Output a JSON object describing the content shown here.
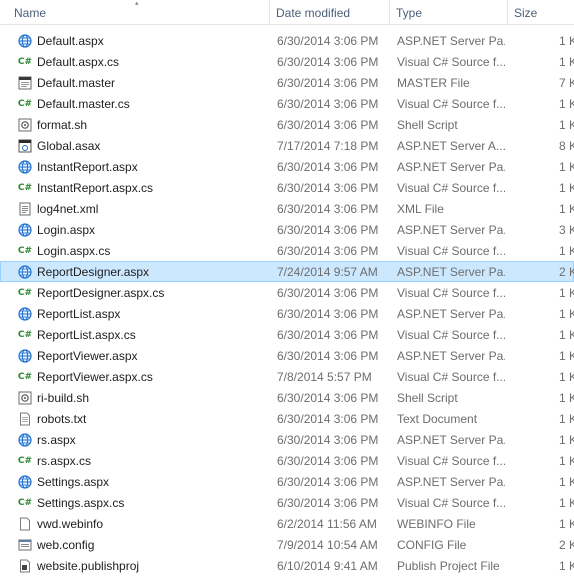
{
  "columns": {
    "name": "Name",
    "date": "Date modified",
    "type": "Type",
    "size": "Size"
  },
  "files": [
    {
      "name": "Default.aspx",
      "date": "6/30/2014 3:06 PM",
      "type": "ASP.NET Server Pa...",
      "size": "1 K",
      "icon": "globe-icon",
      "selected": false
    },
    {
      "name": "Default.aspx.cs",
      "date": "6/30/2014 3:06 PM",
      "type": "Visual C# Source f...",
      "size": "1 K",
      "icon": "csharp-icon",
      "selected": false
    },
    {
      "name": "Default.master",
      "date": "6/30/2014 3:06 PM",
      "type": "MASTER File",
      "size": "7 K",
      "icon": "master-file-icon",
      "selected": false
    },
    {
      "name": "Default.master.cs",
      "date": "6/30/2014 3:06 PM",
      "type": "Visual C# Source f...",
      "size": "1 K",
      "icon": "csharp-icon",
      "selected": false
    },
    {
      "name": "format.sh",
      "date": "6/30/2014 3:06 PM",
      "type": "Shell Script",
      "size": "1 K",
      "icon": "shell-script-icon",
      "selected": false
    },
    {
      "name": "Global.asax",
      "date": "7/17/2014 7:18 PM",
      "type": "ASP.NET Server A...",
      "size": "8 K",
      "icon": "asax-icon",
      "selected": false
    },
    {
      "name": "InstantReport.aspx",
      "date": "6/30/2014 3:06 PM",
      "type": "ASP.NET Server Pa...",
      "size": "1 K",
      "icon": "globe-icon",
      "selected": false
    },
    {
      "name": "InstantReport.aspx.cs",
      "date": "6/30/2014 3:06 PM",
      "type": "Visual C# Source f...",
      "size": "1 K",
      "icon": "csharp-icon",
      "selected": false
    },
    {
      "name": "log4net.xml",
      "date": "6/30/2014 3:06 PM",
      "type": "XML File",
      "size": "1 K",
      "icon": "xml-file-icon",
      "selected": false
    },
    {
      "name": "Login.aspx",
      "date": "6/30/2014 3:06 PM",
      "type": "ASP.NET Server Pa...",
      "size": "3 K",
      "icon": "globe-icon",
      "selected": false
    },
    {
      "name": "Login.aspx.cs",
      "date": "6/30/2014 3:06 PM",
      "type": "Visual C# Source f...",
      "size": "1 K",
      "icon": "csharp-icon",
      "selected": false
    },
    {
      "name": "ReportDesigner.aspx",
      "date": "7/24/2014 9:57 AM",
      "type": "ASP.NET Server Pa...",
      "size": "2 K",
      "icon": "globe-icon",
      "selected": true
    },
    {
      "name": "ReportDesigner.aspx.cs",
      "date": "6/30/2014 3:06 PM",
      "type": "Visual C# Source f...",
      "size": "1 K",
      "icon": "csharp-icon",
      "selected": false
    },
    {
      "name": "ReportList.aspx",
      "date": "6/30/2014 3:06 PM",
      "type": "ASP.NET Server Pa...",
      "size": "1 K",
      "icon": "globe-icon",
      "selected": false
    },
    {
      "name": "ReportList.aspx.cs",
      "date": "6/30/2014 3:06 PM",
      "type": "Visual C# Source f...",
      "size": "1 K",
      "icon": "csharp-icon",
      "selected": false
    },
    {
      "name": "ReportViewer.aspx",
      "date": "6/30/2014 3:06 PM",
      "type": "ASP.NET Server Pa...",
      "size": "1 K",
      "icon": "globe-icon",
      "selected": false
    },
    {
      "name": "ReportViewer.aspx.cs",
      "date": "7/8/2014 5:57 PM",
      "type": "Visual C# Source f...",
      "size": "1 K",
      "icon": "csharp-icon",
      "selected": false
    },
    {
      "name": "ri-build.sh",
      "date": "6/30/2014 3:06 PM",
      "type": "Shell Script",
      "size": "1 K",
      "icon": "shell-script-icon",
      "selected": false
    },
    {
      "name": "robots.txt",
      "date": "6/30/2014 3:06 PM",
      "type": "Text Document",
      "size": "1 K",
      "icon": "text-file-icon",
      "selected": false
    },
    {
      "name": "rs.aspx",
      "date": "6/30/2014 3:06 PM",
      "type": "ASP.NET Server Pa...",
      "size": "1 K",
      "icon": "globe-icon",
      "selected": false
    },
    {
      "name": "rs.aspx.cs",
      "date": "6/30/2014 3:06 PM",
      "type": "Visual C# Source f...",
      "size": "1 K",
      "icon": "csharp-icon",
      "selected": false
    },
    {
      "name": "Settings.aspx",
      "date": "6/30/2014 3:06 PM",
      "type": "ASP.NET Server Pa...",
      "size": "1 K",
      "icon": "globe-icon",
      "selected": false
    },
    {
      "name": "Settings.aspx.cs",
      "date": "6/30/2014 3:06 PM",
      "type": "Visual C# Source f...",
      "size": "1 K",
      "icon": "csharp-icon",
      "selected": false
    },
    {
      "name": "vwd.webinfo",
      "date": "6/2/2014 11:56 AM",
      "type": "WEBINFO File",
      "size": "1 K",
      "icon": "blank-file-icon",
      "selected": false
    },
    {
      "name": "web.config",
      "date": "7/9/2014 10:54 AM",
      "type": "CONFIG File",
      "size": "2 K",
      "icon": "config-file-icon",
      "selected": false
    },
    {
      "name": "website.publishproj",
      "date": "6/10/2014 9:41 AM",
      "type": "Publish Project File",
      "size": "1 K",
      "icon": "publish-project-icon",
      "selected": false
    }
  ],
  "colors": {
    "selected_bg": "#cce8ff",
    "selected_border": "#99d1ff",
    "header_text": "#4c607a",
    "globe": "#1d6fd1",
    "csharp": "#2c8a2c"
  }
}
